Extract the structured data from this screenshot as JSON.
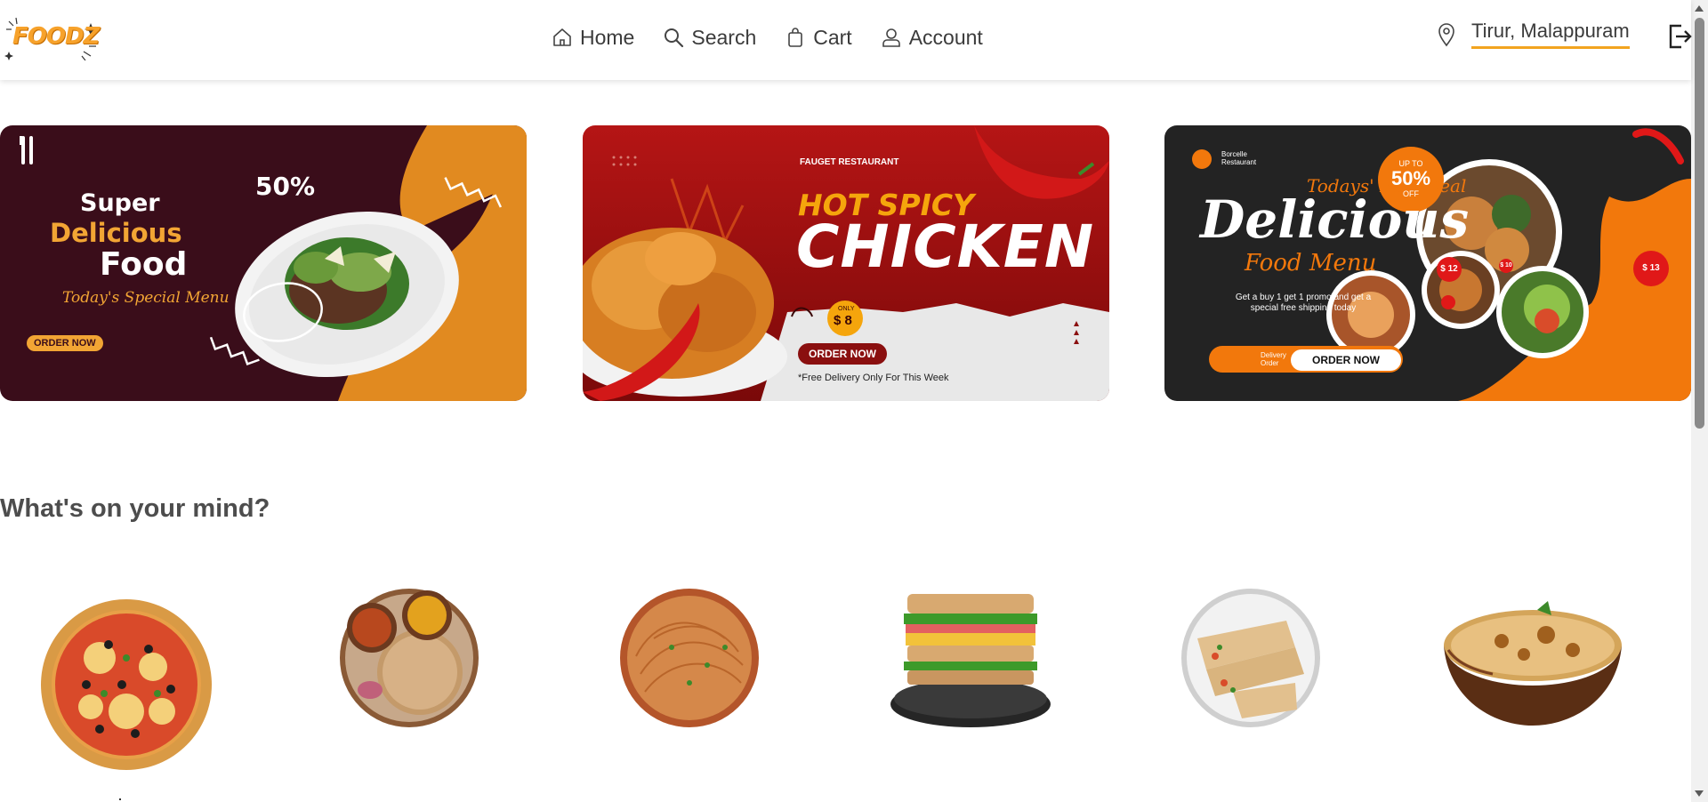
{
  "header": {
    "logo_text": "FOODZ",
    "nav": [
      {
        "label": "Home",
        "icon": "home-icon"
      },
      {
        "label": "Search",
        "icon": "search-icon"
      },
      {
        "label": "Cart",
        "icon": "bag-icon"
      },
      {
        "label": "Account",
        "icon": "user-icon"
      }
    ],
    "location": "Tirur, Malappuram",
    "location_icon": "map-pin-icon",
    "logout_icon": "logout-icon"
  },
  "banners": [
    {
      "kind": "special-menu",
      "line1": "Super",
      "line2": "Delicious",
      "line3": "Food",
      "script": "Today's Special Menu",
      "discount": "50%",
      "button": "ORDER NOW"
    },
    {
      "kind": "hot-spicy",
      "brand": "FAUGET RESTAURANT",
      "headline1": "HOT SPICY",
      "headline2": "CHICKEN",
      "price_only": "ONLY",
      "price": "$ 8",
      "button": "ORDER NOW",
      "note": "*Free Delivery Only For This Week"
    },
    {
      "kind": "best-deal",
      "brand_line1": "Borcelle",
      "brand_line2": "Restaurant",
      "script": "Todays' Best Deal",
      "headline": "Delicious",
      "subhead": "Food Menu",
      "body": "Get a buy 1 get 1 promo and get a special free shipping today",
      "badge_up_to": "UP TO",
      "badge_pct": "50%",
      "badge_off": "OFF",
      "price1": "$ 12",
      "price2": "$ 10",
      "price3": "$ 13",
      "delivery_line1": "Delivery",
      "delivery_line2": "Order",
      "button": "ORDER NOW"
    }
  ],
  "section": {
    "title": "What's on your mind?"
  },
  "foods": [
    {
      "name": "pizza-image"
    },
    {
      "name": "roti-curry-image"
    },
    {
      "name": "noodles-image"
    },
    {
      "name": "sandwich-image"
    },
    {
      "name": "wraps-image"
    },
    {
      "name": "biryani-image"
    }
  ],
  "colors": {
    "accent": "#f2a41f",
    "text": "#3b3b3b",
    "banner1_bg": "#3a0d1a",
    "banner2_bg": "#b51515"
  }
}
